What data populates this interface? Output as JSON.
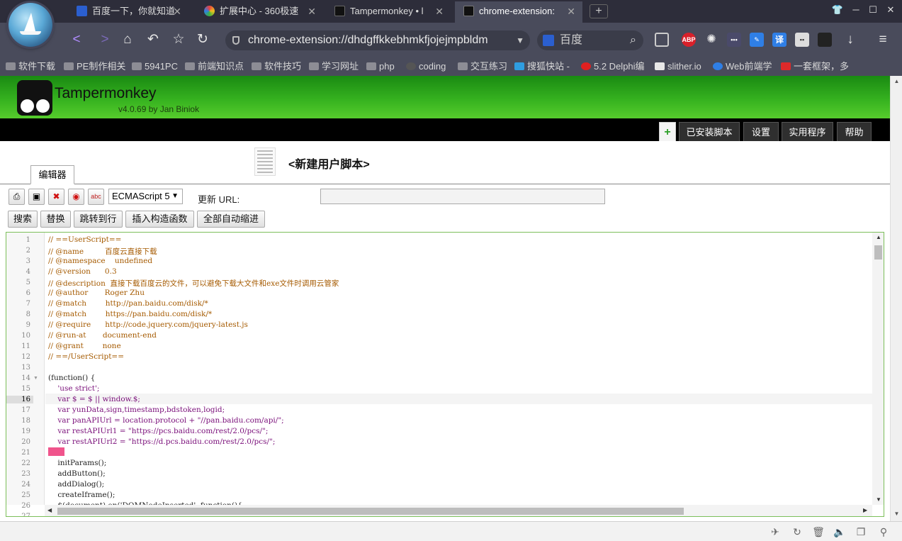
{
  "browser": {
    "tabs": [
      {
        "title": "百度一下，你就知道",
        "icon_color": "#2b5fcf"
      },
      {
        "title": "扩展中心 - 360极速",
        "icon_color": "#e0a020"
      },
      {
        "title": "Tampermonkey • l",
        "icon_color": "#111111"
      },
      {
        "title": "chrome-extension:",
        "icon_color": "#111111",
        "active": true
      }
    ],
    "new_tab_label": "+",
    "url": "chrome-extension://dhdgffkkebhmkfjojejmpbldm",
    "search_placeholder": "百度",
    "extensions": [
      {
        "name": "adblock-plus",
        "label": "ABP",
        "color": "#d9202a"
      },
      {
        "name": "ext-translate",
        "label": "译",
        "color": "#2f7fe6"
      }
    ],
    "bookmarks": [
      {
        "label": "软件下载",
        "icon": "folder-icon"
      },
      {
        "label": "PE制作相关",
        "icon": "folder-icon"
      },
      {
        "label": "5941PC",
        "icon": "folder-icon"
      },
      {
        "label": "前端知识点",
        "icon": "folder-icon"
      },
      {
        "label": "软件技巧",
        "icon": "folder-icon"
      },
      {
        "label": "学习网址",
        "icon": "folder-icon"
      },
      {
        "label": "php",
        "icon": "folder-icon"
      },
      {
        "label": "coding",
        "icon": "coding-icon"
      },
      {
        "label": "交互练习",
        "icon": "folder-icon"
      },
      {
        "label": "搜狐快站 -",
        "icon": "kuaizhan-icon"
      },
      {
        "label": "5.2 Delphi编",
        "icon": "c-icon"
      },
      {
        "label": "slither.io",
        "icon": "page-icon"
      },
      {
        "label": "Web前端学",
        "icon": "globe-icon"
      },
      {
        "label": "一套框架，多",
        "icon": "angular-icon"
      }
    ]
  },
  "tampermonkey": {
    "title": "Tampermonkey",
    "version": "v4.0.69 by Jan Biniok",
    "nav": {
      "add": "+",
      "installed": "已安装脚本",
      "settings": "设置",
      "utilities": "实用程序",
      "help": "帮助"
    },
    "script_title": "<新建用户脚本>",
    "editor_tab": "编辑器",
    "language_select": "ECMAScript 5",
    "update_url_label": "更新 URL:",
    "update_url_value": "",
    "buttons": {
      "search": "搜索",
      "replace": "替换",
      "goto_line": "跳转到行",
      "insert_constructor": "插入构造函数",
      "auto_indent": "全部自动缩进"
    }
  },
  "code_lines": [
    "// ==UserScript==",
    "// @name         百度云直接下载",
    "// @namespace    undefined",
    "// @version      0.3",
    "// @description  直接下载百度云的文件，可以避免下载大文件和exe文件时调用云管家",
    "// @author       Roger Zhu",
    "// @match        http://pan.baidu.com/disk/*",
    "// @match        https://pan.baidu.com/disk/*",
    "// @require      http://code.jquery.com/jquery-latest.js",
    "// @run-at       document-end",
    "// @grant        none",
    "// ==/UserScript==",
    "",
    "(function() {",
    "    'use strict';",
    "    var $ = $ || window.$;",
    "    var yunData,sign,timestamp,bdstoken,logid;",
    "    var panAPIUrl = location.protocol + \"//pan.baidu.com/api/\";",
    "    var restAPIUrl1 = \"https://pcs.baidu.com/rest/2.0/pcs/\";",
    "    var restAPIUrl2 = \"https://d.pcs.baidu.com/rest/2.0/pcs/\";",
    "",
    "    initParams();",
    "    addButton();",
    "    addDialog();",
    "    createIframe();",
    "    $(document).on('DOMNodeInserted', function(){"
  ],
  "line_numbers": [
    "1",
    "2",
    "3",
    "4",
    "5",
    "6",
    "7",
    "8",
    "9",
    "10",
    "11",
    "12",
    "13",
    "14",
    "15",
    "16",
    "17",
    "18",
    "19",
    "20",
    "21",
    "22",
    "23",
    "24",
    "25",
    "26",
    "27"
  ],
  "current_line": 16
}
